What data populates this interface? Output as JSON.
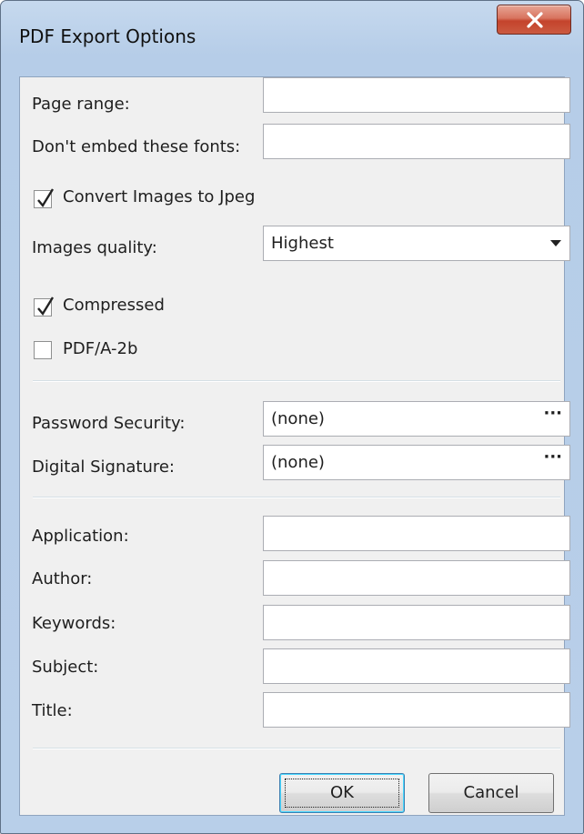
{
  "window": {
    "title": "PDF Export Options",
    "close_icon": "close-icon"
  },
  "fields": {
    "page_range": {
      "label": "Page range:",
      "value": ""
    },
    "dont_embed_fonts": {
      "label": "Don't embed these fonts:",
      "value": ""
    },
    "convert_images": {
      "label": "Convert Images to Jpeg",
      "checked": true
    },
    "images_quality": {
      "label": "Images quality:",
      "value": "Highest",
      "options": [
        "Highest"
      ]
    },
    "compressed": {
      "label": "Compressed",
      "checked": true
    },
    "pdfa": {
      "label": "PDF/A-2b",
      "checked": false
    },
    "password_security": {
      "label": "Password Security:",
      "value": "(none)",
      "button": "···"
    },
    "digital_signature": {
      "label": "Digital Signature:",
      "value": "(none)",
      "button": "···"
    },
    "application": {
      "label": "Application:",
      "value": ""
    },
    "author": {
      "label": "Author:",
      "value": ""
    },
    "keywords": {
      "label": "Keywords:",
      "value": ""
    },
    "subject": {
      "label": "Subject:",
      "value": ""
    },
    "title": {
      "label": "Title:",
      "value": ""
    }
  },
  "buttons": {
    "ok": "OK",
    "cancel": "Cancel"
  },
  "colors": {
    "title_bar": "#b9cfe9",
    "close_button": "#c9503a",
    "client_bg": "#f0f0f0",
    "default_button_border": "#3c7fb1"
  }
}
